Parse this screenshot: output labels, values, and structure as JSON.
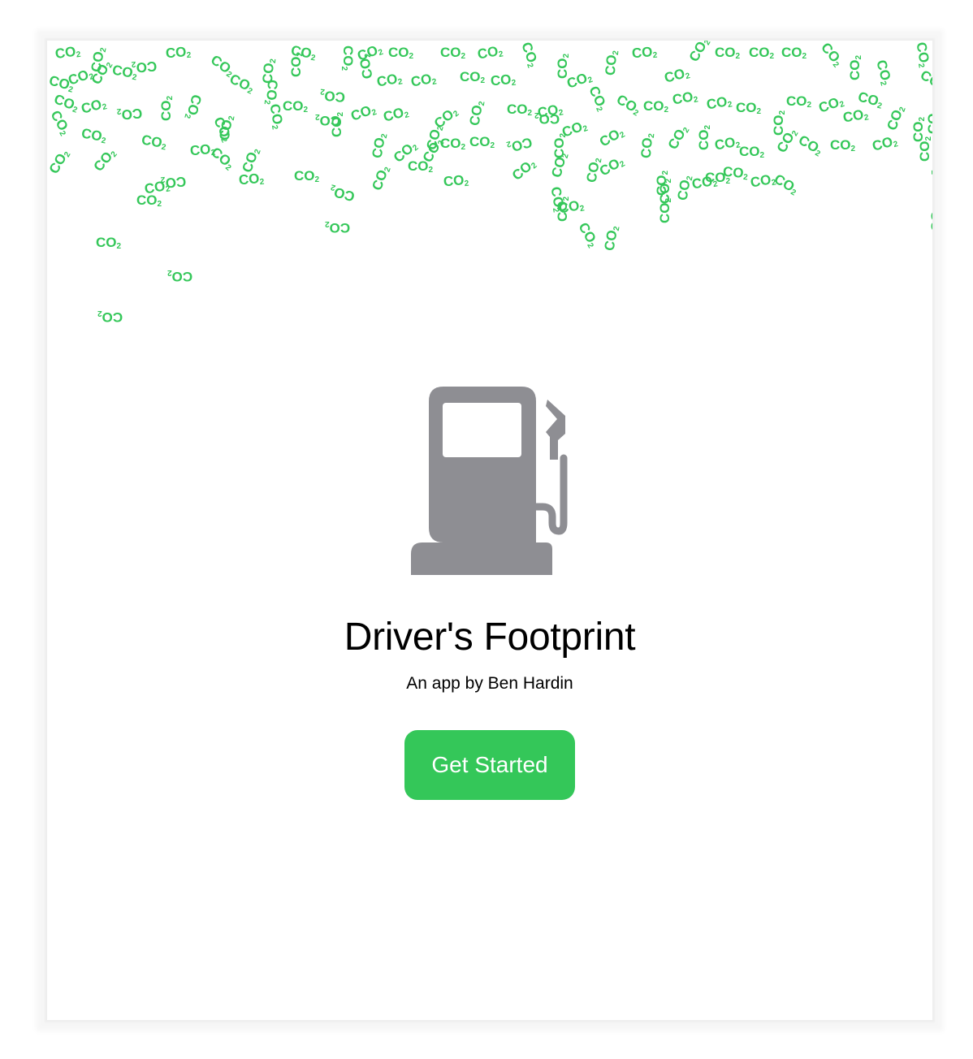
{
  "app": {
    "title": "Driver's Footprint",
    "subtitle": "An app by Ben Hardin",
    "cta_label": "Get Started"
  },
  "decoration": {
    "co2_label": "CO",
    "co2_subscript": "2"
  },
  "icons": {
    "hero": "fuel-pump-icon"
  },
  "colors": {
    "accent_green": "#34C759",
    "pump_gray": "#8E8E93",
    "title_text": "#000000"
  }
}
